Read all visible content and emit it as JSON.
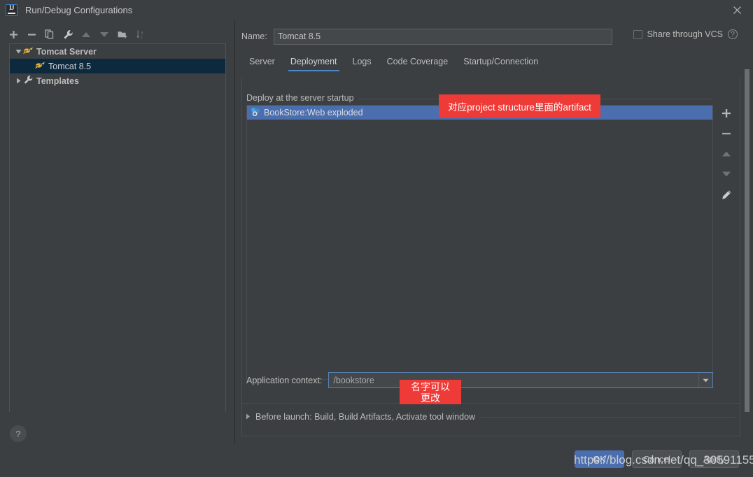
{
  "window": {
    "title": "Run/Debug Configurations",
    "logo_icon": "intellij-idea-logo",
    "close_icon": "close-icon"
  },
  "left_panel": {
    "toolbar": [
      {
        "name": "add-configuration-button",
        "icon": "plus-icon"
      },
      {
        "name": "remove-configuration-button",
        "icon": "minus-icon"
      },
      {
        "name": "copy-configuration-button",
        "icon": "copy-icon"
      },
      {
        "name": "edit-templates-button",
        "icon": "wrench-icon"
      },
      {
        "name": "move-up-button",
        "icon": "arrow-up-icon"
      },
      {
        "name": "move-down-button",
        "icon": "arrow-down-icon"
      },
      {
        "name": "new-folder-button",
        "icon": "folder-add-icon"
      },
      {
        "name": "sort-configurations-button",
        "icon": "sort-az-icon"
      }
    ],
    "tree": [
      {
        "label": "Tomcat Server",
        "icon": "tomcat-icon",
        "twisty": "expanded",
        "level": 0,
        "selected": false
      },
      {
        "label": "Tomcat 8.5",
        "icon": "tomcat-icon",
        "twisty": "none",
        "level": 1,
        "selected": true
      },
      {
        "label": "Templates",
        "icon": "wrench-icon",
        "twisty": "collapsed",
        "level": 0,
        "selected": false
      }
    ],
    "help_button": {
      "label": "?",
      "name": "help-button"
    }
  },
  "main": {
    "name_label": "Name:",
    "name_value": "Tomcat 8.5",
    "share_vcs_label": "Share through VCS",
    "share_vcs_checked": false,
    "share_vcs_help": "?",
    "tabs": [
      {
        "label": "Server",
        "active": false
      },
      {
        "label": "Deployment",
        "active": true
      },
      {
        "label": "Logs",
        "active": false
      },
      {
        "label": "Code Coverage",
        "active": false
      },
      {
        "label": "Startup/Connection",
        "active": false
      }
    ],
    "deploy_group_title": "Deploy at the server startup",
    "deploy_rows": [
      {
        "label": "BookStore:Web exploded",
        "icon": "artifact-icon",
        "selected": true
      }
    ],
    "list_tools": [
      {
        "name": "add-artifact-button",
        "icon": "plus-icon"
      },
      {
        "name": "remove-artifact-button",
        "icon": "minus-icon"
      },
      {
        "name": "move-artifact-up-button",
        "icon": "arrow-up-icon"
      },
      {
        "name": "move-artifact-down-button",
        "icon": "arrow-down-icon"
      },
      {
        "name": "edit-artifact-button",
        "icon": "pencil-icon"
      }
    ],
    "app_context_label": "Application context:",
    "app_context_value": "/bookstore",
    "before_launch_label": "Before launch: Build, Build Artifacts, Activate tool window"
  },
  "buttons": {
    "ok": "OK",
    "cancel": "Cancel",
    "apply": "Apply"
  },
  "annotations": [
    {
      "text": "对应project  structure里面的artifact",
      "color": "#ee3b38"
    },
    {
      "line1": "名字可以",
      "line2": "更改",
      "color": "#ee3b38"
    }
  ],
  "watermark": "https://blog.csdn.net/qq_30591155",
  "colors": {
    "background": "#3c3f41",
    "selection_blue": "#4b6eaf",
    "tree_selection": "#0d293e",
    "accent": "#4a88c7",
    "annotation_red": "#ee3b38"
  }
}
